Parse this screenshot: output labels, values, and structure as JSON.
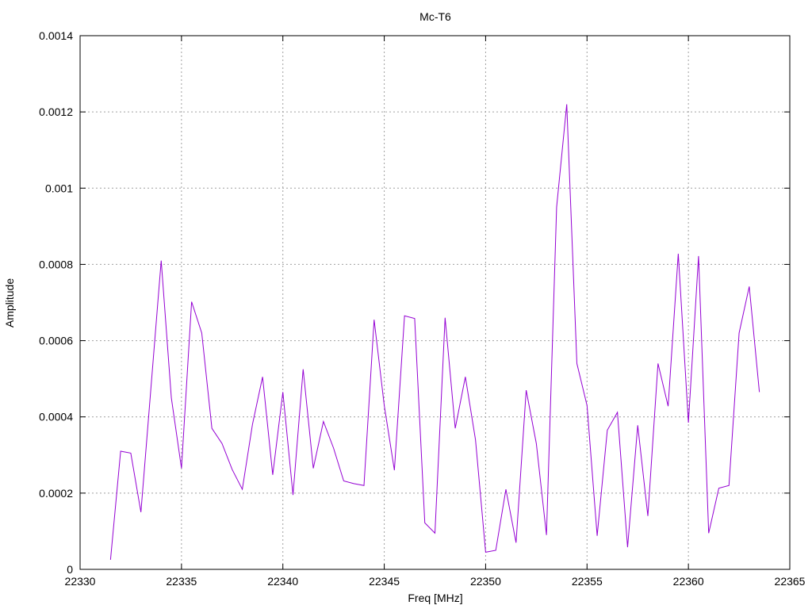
{
  "chart_data": {
    "type": "line",
    "title": "Mc-T6",
    "xlabel": "Freq [MHz]",
    "ylabel": "Amplitude",
    "xlim": [
      22330,
      22365
    ],
    "ylim": [
      0,
      0.0014
    ],
    "xticks": [
      22330,
      22335,
      22340,
      22345,
      22350,
      22355,
      22360,
      22365
    ],
    "xtick_labels": [
      "22330",
      "22335",
      "22340",
      "22345",
      "22350",
      "22355",
      "22360",
      "22365"
    ],
    "yticks": [
      0,
      0.0002,
      0.0004,
      0.0006,
      0.0008,
      0.001,
      0.0012,
      0.0014
    ],
    "ytick_labels": [
      "0",
      "0.0002",
      "0.0004",
      "0.0006",
      "0.0008",
      "0.001",
      "0.0012",
      "0.0014"
    ],
    "grid": true,
    "series": [
      {
        "color": "#9400d3",
        "x": [
          22331.5,
          22332,
          22332.5,
          22333,
          22333.5,
          22334,
          22334.5,
          22335,
          22335.5,
          22336,
          22336.5,
          22337,
          22337.5,
          22338,
          22338.5,
          22339,
          22339.5,
          22340,
          22340.5,
          22341,
          22341.5,
          22342,
          22342.5,
          22343,
          22343.5,
          22344,
          22344.5,
          22345,
          22345.5,
          22346,
          22346.5,
          22347,
          22347.5,
          22348,
          22348.5,
          22349,
          22349.5,
          22350,
          22350.5,
          22351,
          22351.5,
          22352,
          22352.5,
          22353,
          22353.5,
          22354,
          22354.5,
          22355,
          22355.5,
          22356,
          22356.5,
          22357,
          22357.5,
          22358,
          22358.5,
          22359,
          22359.5,
          22360,
          22360.5,
          22361,
          22361.5,
          22362,
          22362.5,
          22363,
          22363.5
        ],
        "y": [
          2.5e-05,
          0.00031,
          0.000305,
          0.00015,
          0.00048,
          0.00081,
          0.00045,
          0.000265,
          0.000702,
          0.00062,
          0.00037,
          0.00033,
          0.000262,
          0.00021,
          0.00038,
          0.000505,
          0.000248,
          0.000465,
          0.000195,
          0.000525,
          0.000265,
          0.000388,
          0.000318,
          0.000232,
          0.000225,
          0.00022,
          0.000655,
          0.00043,
          0.00026,
          0.000665,
          0.000658,
          0.000122,
          9.5e-05,
          0.00066,
          0.00037,
          0.000505,
          0.00034,
          4.5e-05,
          5e-05,
          0.00021,
          7e-05,
          0.00047,
          0.00033,
          9e-05,
          0.00095,
          0.00122,
          0.00054,
          0.00043,
          8.8e-05,
          0.000365,
          0.000412,
          5.8e-05,
          0.000378,
          0.00014,
          0.00054,
          0.000428,
          0.000828,
          0.000385,
          0.000822,
          9.5e-05,
          0.000213,
          0.00022,
          0.00062,
          0.000742,
          0.000465
        ]
      }
    ]
  },
  "colors": {
    "series": "#9400d3",
    "grid": "#a0a0a0",
    "axis": "#000000",
    "background": "#ffffff"
  }
}
